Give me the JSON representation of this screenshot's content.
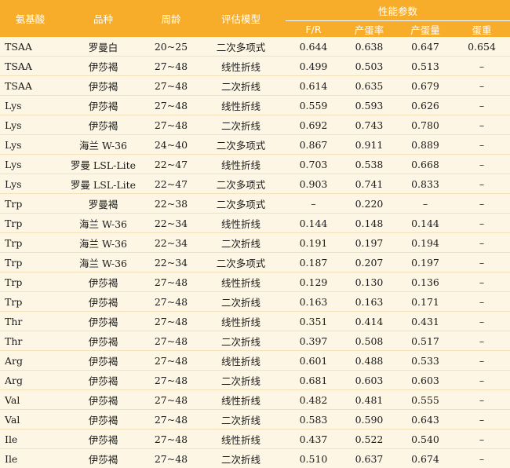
{
  "header": {
    "amino_acid": "氨基酸",
    "breed": "品种",
    "age": "周龄",
    "model": "评估模型",
    "performance": "性能参数",
    "fr": "F/R",
    "egg_rate": "产蛋率",
    "egg_mass": "产蛋量",
    "egg_weight": "蛋重"
  },
  "rows": [
    [
      "TSAA",
      "罗曼白",
      "20~25",
      "二次多项式",
      "0.644",
      "0.638",
      "0.647",
      "0.654"
    ],
    [
      "TSAA",
      "伊莎褐",
      "27~48",
      "线性折线",
      "0.499",
      "0.503",
      "0.513",
      "–"
    ],
    [
      "TSAA",
      "伊莎褐",
      "27~48",
      "二次折线",
      "0.614",
      "0.635",
      "0.679",
      "–"
    ],
    [
      "Lys",
      "伊莎褐",
      "27~48",
      "线性折线",
      "0.559",
      "0.593",
      "0.626",
      "–"
    ],
    [
      "Lys",
      "伊莎褐",
      "27~48",
      "二次折线",
      "0.692",
      "0.743",
      "0.780",
      "–"
    ],
    [
      "Lys",
      "海兰 W-36",
      "24~40",
      "二次多项式",
      "0.867",
      "0.911",
      "0.889",
      "–"
    ],
    [
      "Lys",
      "罗曼 LSL-Lite",
      "22~47",
      "线性折线",
      "0.703",
      "0.538",
      "0.668",
      "–"
    ],
    [
      "Lys",
      "罗曼 LSL-Lite",
      "22~47",
      "二次多项式",
      "0.903",
      "0.741",
      "0.833",
      "–"
    ],
    [
      "Trp",
      "罗曼褐",
      "22~38",
      "二次多项式",
      "–",
      "0.220",
      "–",
      "–"
    ],
    [
      "Trp",
      "海兰 W-36",
      "22~34",
      "线性折线",
      "0.144",
      "0.148",
      "0.144",
      "–"
    ],
    [
      "Trp",
      "海兰 W-36",
      "22~34",
      "二次折线",
      "0.191",
      "0.197",
      "0.194",
      "–"
    ],
    [
      "Trp",
      "海兰 W-36",
      "22~34",
      "二次多项式",
      "0.187",
      "0.207",
      "0.197",
      "–"
    ],
    [
      "Trp",
      "伊莎褐",
      "27~48",
      "线性折线",
      "0.129",
      "0.130",
      "0.136",
      "–"
    ],
    [
      "Trp",
      "伊莎褐",
      "27~48",
      "二次折线",
      "0.163",
      "0.163",
      "0.171",
      "–"
    ],
    [
      "Thr",
      "伊莎褐",
      "27~48",
      "线性折线",
      "0.351",
      "0.414",
      "0.431",
      "–"
    ],
    [
      "Thr",
      "伊莎褐",
      "27~48",
      "二次折线",
      "0.397",
      "0.508",
      "0.517",
      "–"
    ],
    [
      "Arg",
      "伊莎褐",
      "27~48",
      "线性折线",
      "0.601",
      "0.488",
      "0.533",
      "–"
    ],
    [
      "Arg",
      "伊莎褐",
      "27~48",
      "二次折线",
      "0.681",
      "0.603",
      "0.603",
      "–"
    ],
    [
      "Val",
      "伊莎褐",
      "27~48",
      "线性折线",
      "0.482",
      "0.481",
      "0.555",
      "–"
    ],
    [
      "Val",
      "伊莎褐",
      "27~48",
      "二次折线",
      "0.583",
      "0.590",
      "0.643",
      "–"
    ],
    [
      "Ile",
      "伊莎褐",
      "27~48",
      "线性折线",
      "0.437",
      "0.522",
      "0.540",
      "–"
    ],
    [
      "Ile",
      "伊莎褐",
      "27~48",
      "二次折线",
      "0.510",
      "0.637",
      "0.674",
      "–"
    ]
  ],
  "colors": {
    "header_bg": "#f7ad2a",
    "body_bg": "#fef6e5"
  }
}
